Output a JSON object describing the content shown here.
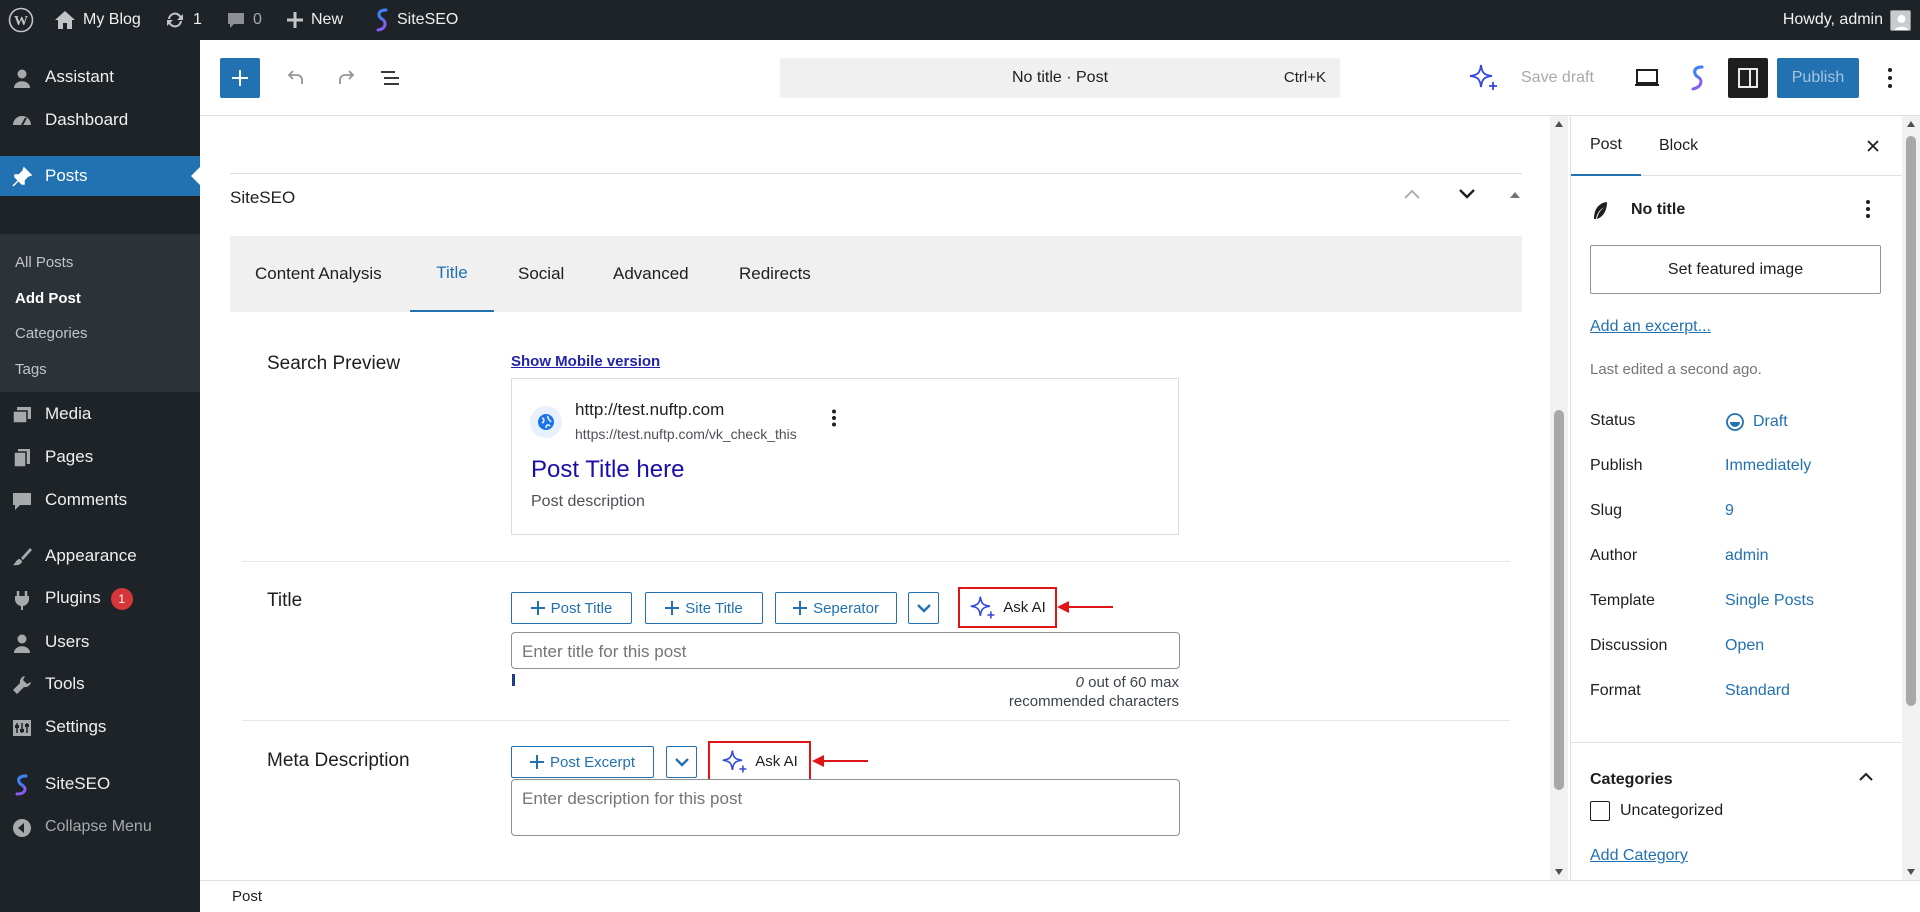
{
  "admin_bar": {
    "site_name": "My Blog",
    "updates_count": "1",
    "comments_count": "0",
    "new_label": "New",
    "plugin_label": "SiteSEO",
    "greeting": "Howdy, admin"
  },
  "sidebar": {
    "items": [
      {
        "label": "Assistant",
        "icon": "user-icon"
      },
      {
        "label": "Dashboard",
        "icon": "dashboard-icon"
      },
      {
        "label": "Posts",
        "icon": "pin-icon"
      },
      {
        "label": "Media",
        "icon": "media-icon"
      },
      {
        "label": "Pages",
        "icon": "pages-icon"
      },
      {
        "label": "Comments",
        "icon": "comment-icon"
      },
      {
        "label": "Appearance",
        "icon": "brush-icon"
      },
      {
        "label": "Plugins",
        "icon": "plugin-icon",
        "badge": "1"
      },
      {
        "label": "Users",
        "icon": "users-icon"
      },
      {
        "label": "Tools",
        "icon": "wrench-icon"
      },
      {
        "label": "Settings",
        "icon": "settings-icon"
      },
      {
        "label": "SiteSEO",
        "icon": "siteseo-icon"
      },
      {
        "label": "Collapse Menu",
        "icon": "collapse-icon"
      }
    ],
    "submenu": [
      "All Posts",
      "Add Post",
      "Categories",
      "Tags"
    ]
  },
  "toolbar": {
    "command_bar_text": "No title · Post",
    "shortcut": "Ctrl+K",
    "save_draft": "Save draft",
    "publish": "Publish"
  },
  "metabox": {
    "title": "SiteSEO",
    "tabs": [
      "Content Analysis",
      "Title",
      "Social",
      "Advanced",
      "Redirects"
    ],
    "selected_tab": "Title",
    "search_preview": {
      "label": "Search Preview",
      "mobile_link": "Show Mobile version",
      "site_url": "http://test.nuftp.com",
      "permalink": "https://test.nuftp.com/vk_check_this",
      "post_title": "Post Title here",
      "post_description": "Post description"
    },
    "title_section": {
      "label": "Title",
      "buttons": [
        "Post Title",
        "Site Title",
        "Seperator"
      ],
      "ask_ai": "Ask AI",
      "placeholder": "Enter title for this post",
      "count": "0",
      "count_text": " out of 60 max",
      "count_text2": "recommended characters"
    },
    "meta_section": {
      "label": "Meta Description",
      "buttons": [
        "Post Excerpt"
      ],
      "ask_ai": "Ask AI",
      "placeholder": "Enter description for this post"
    },
    "accent_color": "#2271b1",
    "highlight_color": "#e01616"
  },
  "status_bar": {
    "breadcrumb": "Post"
  },
  "settings_panel": {
    "tabs": [
      "Post",
      "Block"
    ],
    "post_title": "No title",
    "featured_image": "Set featured image",
    "excerpt_link": "Add an excerpt...",
    "last_edited": "Last edited a second ago.",
    "rows": [
      {
        "label": "Status",
        "value": "Draft"
      },
      {
        "label": "Publish",
        "value": "Immediately"
      },
      {
        "label": "Slug",
        "value": "9"
      },
      {
        "label": "Author",
        "value": "admin"
      },
      {
        "label": "Template",
        "value": "Single Posts"
      },
      {
        "label": "Discussion",
        "value": "Open"
      },
      {
        "label": "Format",
        "value": "Standard"
      }
    ],
    "categories_title": "Categories",
    "category": "Uncategorized",
    "add_category": "Add Category"
  }
}
